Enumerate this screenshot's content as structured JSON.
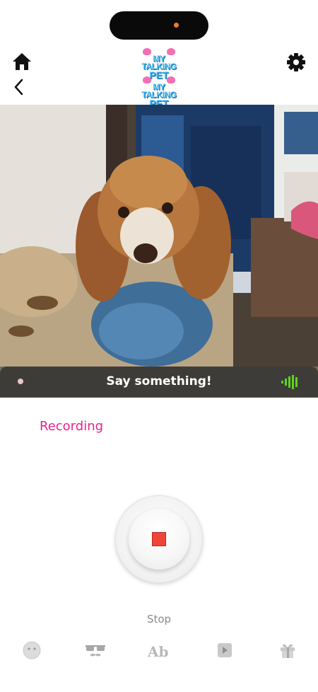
{
  "header": {
    "logo_top": {
      "line1": "MY",
      "line2": "TALKING",
      "line3": "PET"
    },
    "logo_bottom": {
      "line1": "MY",
      "line2": "TALKING",
      "line3": "PET"
    }
  },
  "icons": {
    "home": "home-icon",
    "back": "chevron-left-icon",
    "settings": "gear-icon"
  },
  "speech_bar": {
    "text": "Say something!"
  },
  "status": {
    "label": "Recording",
    "color": "#e8218f"
  },
  "record_button": {
    "label": "Stop",
    "stop_color": "#f0443a"
  },
  "tabbar": {
    "items": [
      {
        "icon": "face-icon"
      },
      {
        "icon": "sunglasses-mustache-icon"
      },
      {
        "icon": "text-icon",
        "label": "Ab"
      },
      {
        "icon": "play-icon"
      },
      {
        "icon": "gift-icon"
      }
    ]
  }
}
